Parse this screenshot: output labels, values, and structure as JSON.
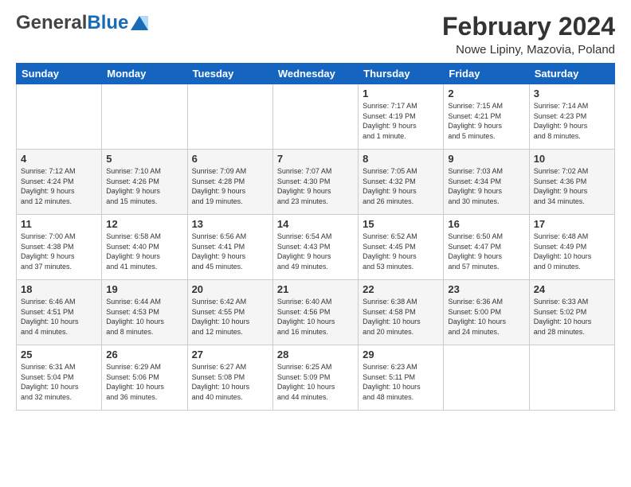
{
  "header": {
    "logo_general": "General",
    "logo_blue": "Blue",
    "month_year": "February 2024",
    "location": "Nowe Lipiny, Mazovia, Poland"
  },
  "days_of_week": [
    "Sunday",
    "Monday",
    "Tuesday",
    "Wednesday",
    "Thursday",
    "Friday",
    "Saturday"
  ],
  "weeks": [
    [
      {
        "day": "",
        "info": ""
      },
      {
        "day": "",
        "info": ""
      },
      {
        "day": "",
        "info": ""
      },
      {
        "day": "",
        "info": ""
      },
      {
        "day": "1",
        "info": "Sunrise: 7:17 AM\nSunset: 4:19 PM\nDaylight: 9 hours\nand 1 minute."
      },
      {
        "day": "2",
        "info": "Sunrise: 7:15 AM\nSunset: 4:21 PM\nDaylight: 9 hours\nand 5 minutes."
      },
      {
        "day": "3",
        "info": "Sunrise: 7:14 AM\nSunset: 4:23 PM\nDaylight: 9 hours\nand 8 minutes."
      }
    ],
    [
      {
        "day": "4",
        "info": "Sunrise: 7:12 AM\nSunset: 4:24 PM\nDaylight: 9 hours\nand 12 minutes."
      },
      {
        "day": "5",
        "info": "Sunrise: 7:10 AM\nSunset: 4:26 PM\nDaylight: 9 hours\nand 15 minutes."
      },
      {
        "day": "6",
        "info": "Sunrise: 7:09 AM\nSunset: 4:28 PM\nDaylight: 9 hours\nand 19 minutes."
      },
      {
        "day": "7",
        "info": "Sunrise: 7:07 AM\nSunset: 4:30 PM\nDaylight: 9 hours\nand 23 minutes."
      },
      {
        "day": "8",
        "info": "Sunrise: 7:05 AM\nSunset: 4:32 PM\nDaylight: 9 hours\nand 26 minutes."
      },
      {
        "day": "9",
        "info": "Sunrise: 7:03 AM\nSunset: 4:34 PM\nDaylight: 9 hours\nand 30 minutes."
      },
      {
        "day": "10",
        "info": "Sunrise: 7:02 AM\nSunset: 4:36 PM\nDaylight: 9 hours\nand 34 minutes."
      }
    ],
    [
      {
        "day": "11",
        "info": "Sunrise: 7:00 AM\nSunset: 4:38 PM\nDaylight: 9 hours\nand 37 minutes."
      },
      {
        "day": "12",
        "info": "Sunrise: 6:58 AM\nSunset: 4:40 PM\nDaylight: 9 hours\nand 41 minutes."
      },
      {
        "day": "13",
        "info": "Sunrise: 6:56 AM\nSunset: 4:41 PM\nDaylight: 9 hours\nand 45 minutes."
      },
      {
        "day": "14",
        "info": "Sunrise: 6:54 AM\nSunset: 4:43 PM\nDaylight: 9 hours\nand 49 minutes."
      },
      {
        "day": "15",
        "info": "Sunrise: 6:52 AM\nSunset: 4:45 PM\nDaylight: 9 hours\nand 53 minutes."
      },
      {
        "day": "16",
        "info": "Sunrise: 6:50 AM\nSunset: 4:47 PM\nDaylight: 9 hours\nand 57 minutes."
      },
      {
        "day": "17",
        "info": "Sunrise: 6:48 AM\nSunset: 4:49 PM\nDaylight: 10 hours\nand 0 minutes."
      }
    ],
    [
      {
        "day": "18",
        "info": "Sunrise: 6:46 AM\nSunset: 4:51 PM\nDaylight: 10 hours\nand 4 minutes."
      },
      {
        "day": "19",
        "info": "Sunrise: 6:44 AM\nSunset: 4:53 PM\nDaylight: 10 hours\nand 8 minutes."
      },
      {
        "day": "20",
        "info": "Sunrise: 6:42 AM\nSunset: 4:55 PM\nDaylight: 10 hours\nand 12 minutes."
      },
      {
        "day": "21",
        "info": "Sunrise: 6:40 AM\nSunset: 4:56 PM\nDaylight: 10 hours\nand 16 minutes."
      },
      {
        "day": "22",
        "info": "Sunrise: 6:38 AM\nSunset: 4:58 PM\nDaylight: 10 hours\nand 20 minutes."
      },
      {
        "day": "23",
        "info": "Sunrise: 6:36 AM\nSunset: 5:00 PM\nDaylight: 10 hours\nand 24 minutes."
      },
      {
        "day": "24",
        "info": "Sunrise: 6:33 AM\nSunset: 5:02 PM\nDaylight: 10 hours\nand 28 minutes."
      }
    ],
    [
      {
        "day": "25",
        "info": "Sunrise: 6:31 AM\nSunset: 5:04 PM\nDaylight: 10 hours\nand 32 minutes."
      },
      {
        "day": "26",
        "info": "Sunrise: 6:29 AM\nSunset: 5:06 PM\nDaylight: 10 hours\nand 36 minutes."
      },
      {
        "day": "27",
        "info": "Sunrise: 6:27 AM\nSunset: 5:08 PM\nDaylight: 10 hours\nand 40 minutes."
      },
      {
        "day": "28",
        "info": "Sunrise: 6:25 AM\nSunset: 5:09 PM\nDaylight: 10 hours\nand 44 minutes."
      },
      {
        "day": "29",
        "info": "Sunrise: 6:23 AM\nSunset: 5:11 PM\nDaylight: 10 hours\nand 48 minutes."
      },
      {
        "day": "",
        "info": ""
      },
      {
        "day": "",
        "info": ""
      }
    ]
  ]
}
